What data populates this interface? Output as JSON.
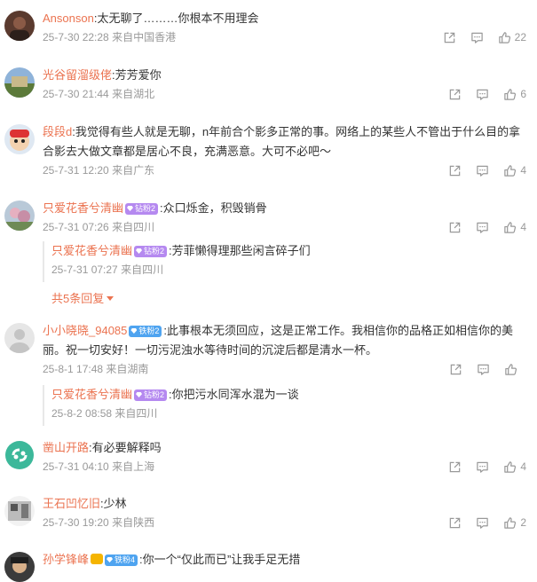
{
  "comments": [
    {
      "user": "Ansonson",
      "text": ":太无聊了………你根本不用理会",
      "time": "25-7-30 22:28",
      "location": "来自中国香港",
      "likes": "22"
    },
    {
      "user": "光谷留溜级佬",
      "text": ":芳芳爱你",
      "time": "25-7-30 21:44",
      "location": "来自湖北",
      "likes": "6"
    },
    {
      "user": "段段d",
      "text_line1": ":我觉得有些人就是无聊，n年前合个影多正常的事。网络上的某些人不管出于什么目的拿",
      "text_line2": "合影去大做文章都是居心不良，充满恶意。大可不必吧～",
      "time": "25-7-31 12:20",
      "location": "来自广东",
      "likes": "4"
    },
    {
      "user": "只爱花香兮清幽",
      "badge": "钻粉2",
      "text": ":众口烁金，积毁销骨",
      "time": "25-7-31 07:26",
      "location": "来自四川",
      "likes": "4",
      "reply": {
        "user": "只爱花香兮清幽",
        "badge": "钻粉2",
        "text": ":芳菲懒得理那些闲言碎子们",
        "time": "25-7-31 07:27",
        "location": "来自四川"
      },
      "more_replies": "共5条回复"
    },
    {
      "user": "小小晓晓_94085",
      "badge": "铁粉2",
      "text_line1": ":此事根本无须回应，这是正常工作。我相信你的品格正如相信你的美",
      "text_line2": "丽。祝一切安好！一切污泥浊水等待时间的沉淀后都是清水一杯。",
      "time": "25-8-1 17:48",
      "location": "来自湖南",
      "likes": "",
      "reply": {
        "user": "只爱花香兮清幽",
        "badge": "钻粉2",
        "text": ":你把污水同浑水混为一谈",
        "time": "25-8-2 08:58",
        "location": "来自四川"
      }
    },
    {
      "user": "凿山开路",
      "text": ":有必要解释吗",
      "time": "25-7-31 04:10",
      "location": "来自上海",
      "likes": "4"
    },
    {
      "user": "王石凹忆旧",
      "text": ":少林",
      "time": "25-7-30 19:20",
      "location": "来自陕西",
      "likes": "2"
    },
    {
      "user": "孙学锋峰",
      "badge": "铁粉4",
      "text": ":你一个“仅此而已”让我手足无措"
    }
  ],
  "colors": {
    "username": "#eb7350",
    "meta": "#999999",
    "text": "#333333"
  },
  "icons": [
    "share-icon",
    "comment-icon",
    "like-icon"
  ]
}
